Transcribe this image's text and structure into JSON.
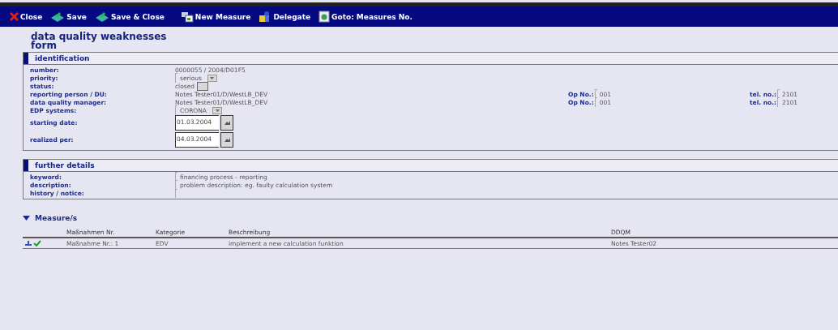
{
  "toolbar": [
    {
      "label": "Close",
      "kind": "close"
    },
    {
      "label": "Save",
      "kind": "save"
    },
    {
      "label": "Save & Close",
      "kind": "save"
    },
    {
      "label": "New Measure",
      "kind": "new"
    },
    {
      "label": "Delegate",
      "kind": "delegate"
    },
    {
      "label": "Goto: Measures No.",
      "kind": "goto"
    }
  ],
  "title": "data quality weaknesses form",
  "sections": [
    {
      "title": "identification",
      "rows": [
        {
          "label": "number:",
          "kind": "text",
          "value": "0000055 / 2004/D01F5"
        },
        {
          "label": "priority:",
          "kind": "select",
          "value": "serious"
        },
        {
          "label": "status:",
          "kind": "lookup",
          "value": "closed"
        },
        {
          "label": "reporting person / DU:",
          "kind": "text",
          "value": "Notes Tester01/D/WestLB_DEV",
          "extras": [
            {
              "label": "Op No.:",
              "value": "001"
            },
            {
              "label": "tel. no.:",
              "value": "2101"
            }
          ]
        },
        {
          "label": "data quality manager:",
          "kind": "text",
          "value": "Notes Tester01/D/WestLB_DEV",
          "extras": [
            {
              "label": "Op No.:",
              "value": "001"
            },
            {
              "label": "tel. no.:",
              "value": "2101"
            }
          ]
        },
        {
          "label": "EDP systems:",
          "kind": "select",
          "value": "CORONA"
        },
        {
          "label": "starting date:",
          "kind": "date",
          "value": "01.03.2004"
        },
        {
          "label": "realized per:",
          "kind": "date",
          "value": "04.03.2004"
        }
      ]
    },
    {
      "title": "further details",
      "rows": [
        {
          "label": "keyword:",
          "kind": "field",
          "value": "financing process - reporting"
        },
        {
          "label": "description:",
          "kind": "field",
          "value": "problem description: eg. faulty calculation system"
        },
        {
          "label": "history / notice:",
          "kind": "field"
        }
      ]
    }
  ],
  "measures": {
    "title": "Measure/s",
    "expanded": true,
    "columns": [
      "Maßnahmen Nr.",
      "Kategorie",
      "Beschreibung",
      "DDQM"
    ],
    "rows": [
      {
        "done": true,
        "cells": [
          "Maßnahme Nr.: 1",
          "EDV",
          "implement a new calculation funktion",
          "Notes Tester02"
        ]
      }
    ]
  }
}
